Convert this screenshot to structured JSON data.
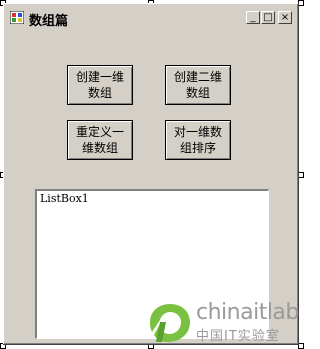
{
  "window": {
    "title": "数组篇",
    "controls": {
      "minimize": "_",
      "maximize": "□",
      "close": "×"
    }
  },
  "buttons": {
    "create_1d": "创建一维数组",
    "create_2d": "创建二维数组",
    "redefine_1d": "重定义一维数组",
    "sort_1d": "对一维数组排序"
  },
  "listbox": {
    "items": [
      "ListBox1"
    ]
  },
  "watermark": {
    "brand": "chinaitlab",
    "subtitle": "中国IT实验室"
  },
  "colors": {
    "form_bg": "#d4d0c8",
    "watermark_green": "#7ac142"
  }
}
